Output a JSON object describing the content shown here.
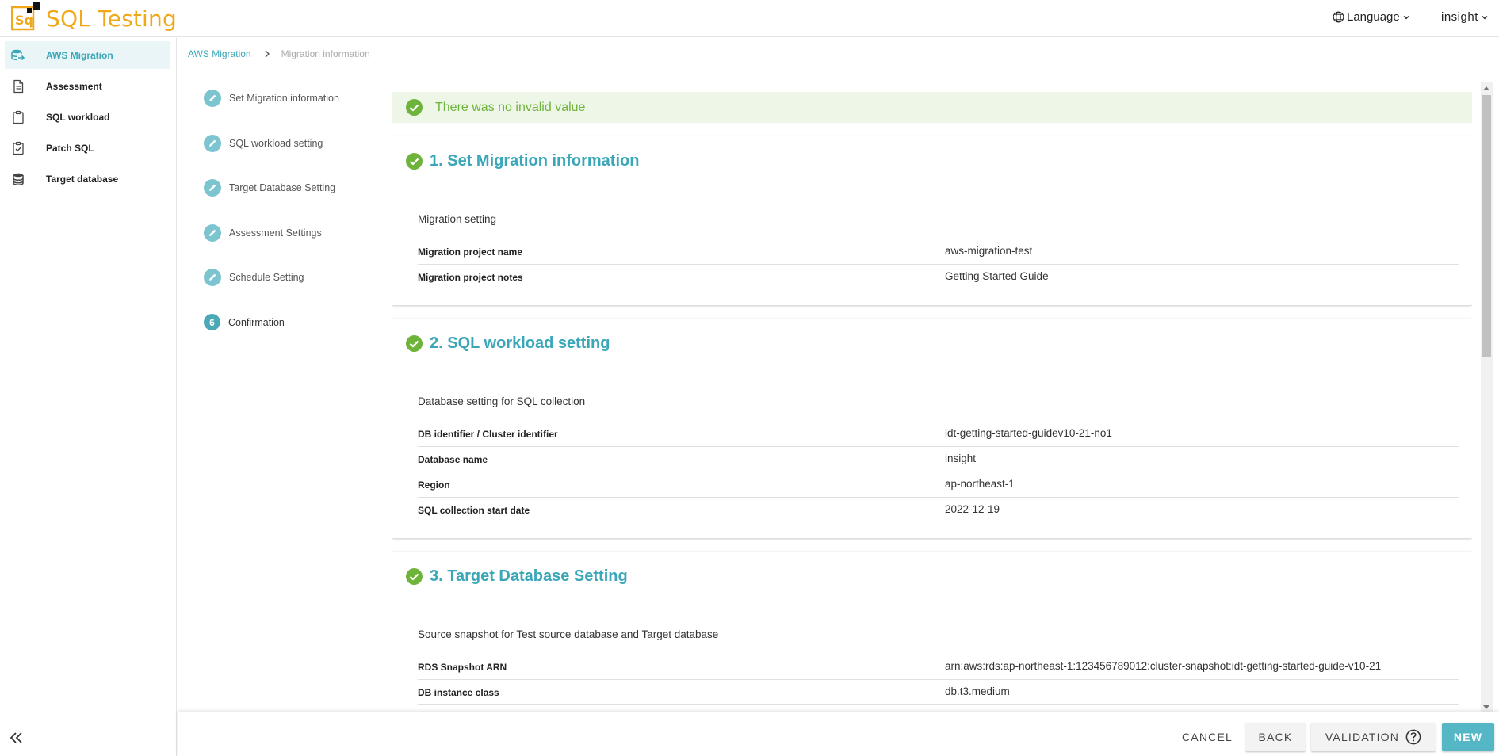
{
  "app": {
    "title": "SQL Testing",
    "brand_color": "#f0a818",
    "accent_color": "#3aa7b8"
  },
  "header": {
    "language_label": "Language",
    "user_label": "insight"
  },
  "sidebar": {
    "items": [
      {
        "label": "AWS Migration",
        "icon": "database-arrow-icon",
        "active": true
      },
      {
        "label": "Assessment",
        "icon": "document-icon",
        "active": false
      },
      {
        "label": "SQL workload",
        "icon": "clipboard-icon",
        "active": false
      },
      {
        "label": "Patch SQL",
        "icon": "clipboard-check-icon",
        "active": false
      },
      {
        "label": "Target database",
        "icon": "database-icon",
        "active": false
      }
    ]
  },
  "breadcrumb": {
    "parent": "AWS Migration",
    "current": "Migration information"
  },
  "steps": [
    {
      "label": "Set Migration information",
      "state": "edited"
    },
    {
      "label": "SQL workload setting",
      "state": "edited"
    },
    {
      "label": "Target Database Setting",
      "state": "edited"
    },
    {
      "label": "Assessment Settings",
      "state": "edited"
    },
    {
      "label": "Schedule Setting",
      "state": "edited"
    },
    {
      "label": "Confirmation",
      "state": "current",
      "number": "6"
    }
  ],
  "alert": {
    "text": "There was no invalid value",
    "color": "#6fb43a"
  },
  "sections": [
    {
      "title": "1. Set Migration information",
      "subtitle": "Migration setting",
      "rows": [
        {
          "key": "Migration project name",
          "value": "aws-migration-test"
        },
        {
          "key": "Migration project notes",
          "value": "Getting Started Guide"
        }
      ]
    },
    {
      "title": "2. SQL workload setting",
      "subtitle": "Database setting for SQL collection",
      "rows": [
        {
          "key": "DB identifier / Cluster identifier",
          "value": "idt-getting-started-guidev10-21-no1"
        },
        {
          "key": "Database name",
          "value": "insight"
        },
        {
          "key": "Region",
          "value": "ap-northeast-1"
        },
        {
          "key": "SQL collection start date",
          "value": "2022-12-19"
        }
      ]
    },
    {
      "title": "3. Target Database Setting",
      "subtitle": "Source snapshot for Test source database and Target database",
      "rows": [
        {
          "key": "RDS Snapshot ARN",
          "value": "arn:aws:rds:ap-northeast-1:123456789012:cluster-snapshot:idt-getting-started-guide-v10-21"
        },
        {
          "key": "DB instance class",
          "value": "db.t3.medium"
        }
      ]
    }
  ],
  "footer": {
    "cancel": "CANCEL",
    "back": "BACK",
    "validation": "VALIDATION",
    "new": "NEW"
  }
}
